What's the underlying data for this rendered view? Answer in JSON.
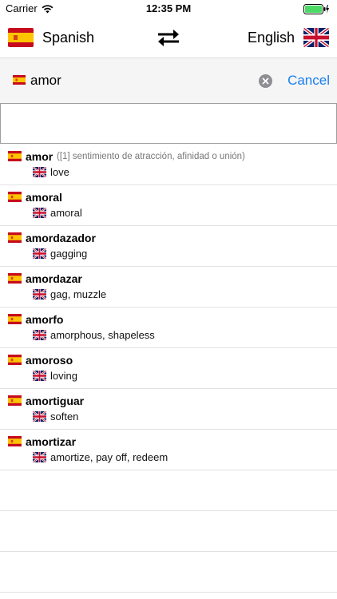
{
  "status_bar": {
    "carrier": "Carrier",
    "time": "12:35 PM",
    "battery_color": "#4cd964"
  },
  "language_bar": {
    "source_language": "Spanish",
    "source_flag": "spain-flag-icon",
    "swap_icon": "swap-arrows-icon",
    "target_language": "English",
    "target_flag": "uk-flag-icon"
  },
  "search": {
    "value": "amor",
    "clear_icon": "clear-x-icon",
    "cancel_label": "Cancel",
    "accent_color": "#1a7ff0"
  },
  "results": [
    {
      "term": "amor",
      "gloss": "([1] sentimiento de atracción, afinidad o unión)",
      "translation": "love"
    },
    {
      "term": "amoral",
      "gloss": "",
      "translation": "amoral"
    },
    {
      "term": "amordazador",
      "gloss": "",
      "translation": "gagging"
    },
    {
      "term": "amordazar",
      "gloss": "",
      "translation": "gag, muzzle"
    },
    {
      "term": "amorfo",
      "gloss": "",
      "translation": "amorphous, shapeless"
    },
    {
      "term": "amoroso",
      "gloss": "",
      "translation": "loving"
    },
    {
      "term": "amortiguar",
      "gloss": "",
      "translation": "soften"
    },
    {
      "term": "amortizar",
      "gloss": "",
      "translation": "amortize, pay off, redeem"
    }
  ],
  "empty_rows": 3
}
